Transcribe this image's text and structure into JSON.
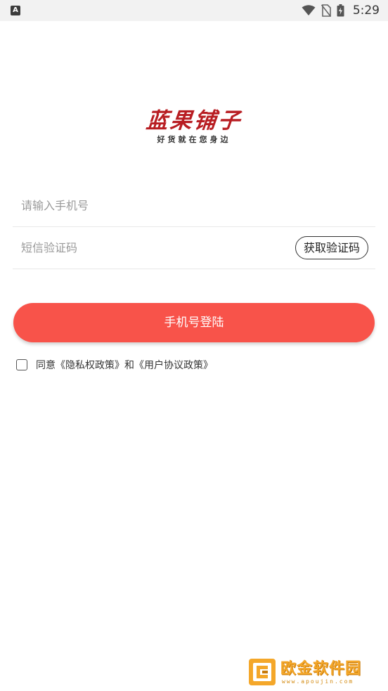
{
  "status_bar": {
    "left_icon_letter": "A",
    "time": "5:29",
    "icons": [
      "wifi-icon",
      "no-sim-icon",
      "battery-icon"
    ]
  },
  "logo": {
    "title": "蓝果铺子",
    "tagline": "好货就在您身边"
  },
  "form": {
    "phone_placeholder": "请输入手机号",
    "phone_value": "",
    "code_placeholder": "短信验证码",
    "code_value": "",
    "get_code_label": "获取验证码",
    "login_label": "手机号登陆"
  },
  "agreement": {
    "prefix": "同意",
    "privacy_link": "《隐私权政策》",
    "conjunction": "和",
    "user_link": "《用户协议政策》",
    "checked": false
  },
  "watermark": {
    "text": "欧金软件园",
    "url": "www.apoujin.com"
  },
  "colors": {
    "accent": "#f8534a",
    "logo_red": "#b81d22",
    "watermark_orange": "#f4a72a"
  }
}
